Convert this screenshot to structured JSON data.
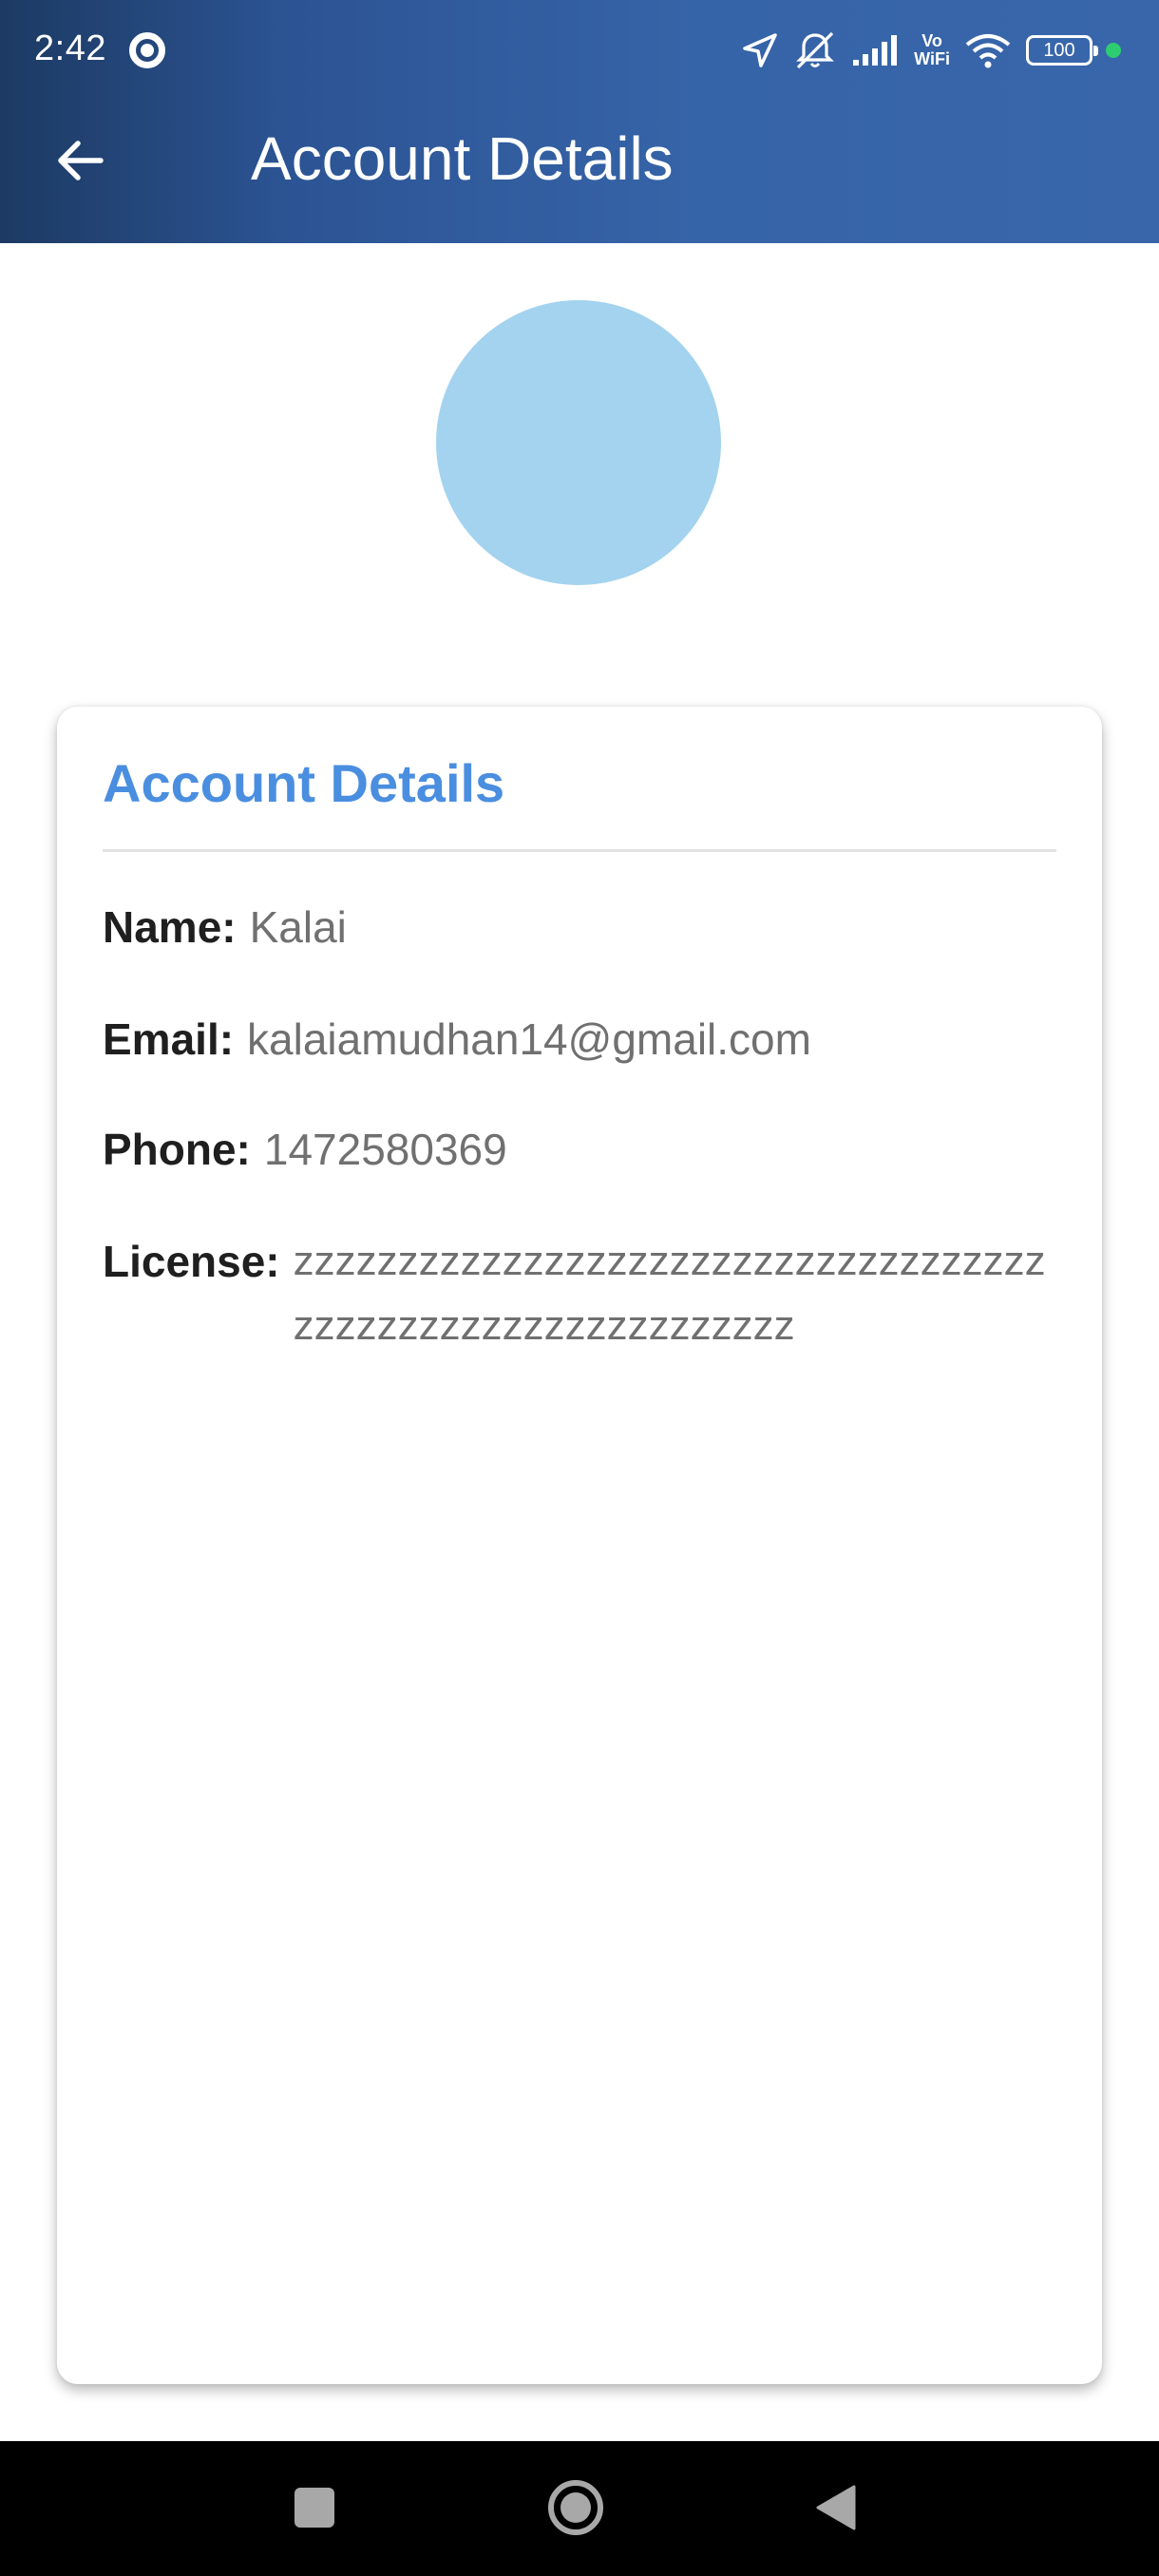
{
  "status_bar": {
    "time": "2:42",
    "network": "Vo\nWiFi",
    "battery": "100"
  },
  "app_bar": {
    "title": "Account Details"
  },
  "card": {
    "title": "Account Details",
    "fields": {
      "name": {
        "label": "Name:",
        "value": "Kalai"
      },
      "email": {
        "label": "Email:",
        "value": "kalaiamudhan14@gmail.com"
      },
      "phone": {
        "label": "Phone:",
        "value": "1472580369"
      },
      "license": {
        "label": "License:",
        "value": "zzzzzzzzzzzzzzzzzzzzzzzzzzzzzzzzzzzzzzzzzzzzzzzzzzzzzzzzzzzz"
      }
    }
  },
  "colors": {
    "app_bar_dark": "#1c3a63",
    "app_bar_light": "#3966aa",
    "card_title": "#4a8ee0",
    "avatar": "#a3d3ee",
    "value_text": "#707070"
  }
}
